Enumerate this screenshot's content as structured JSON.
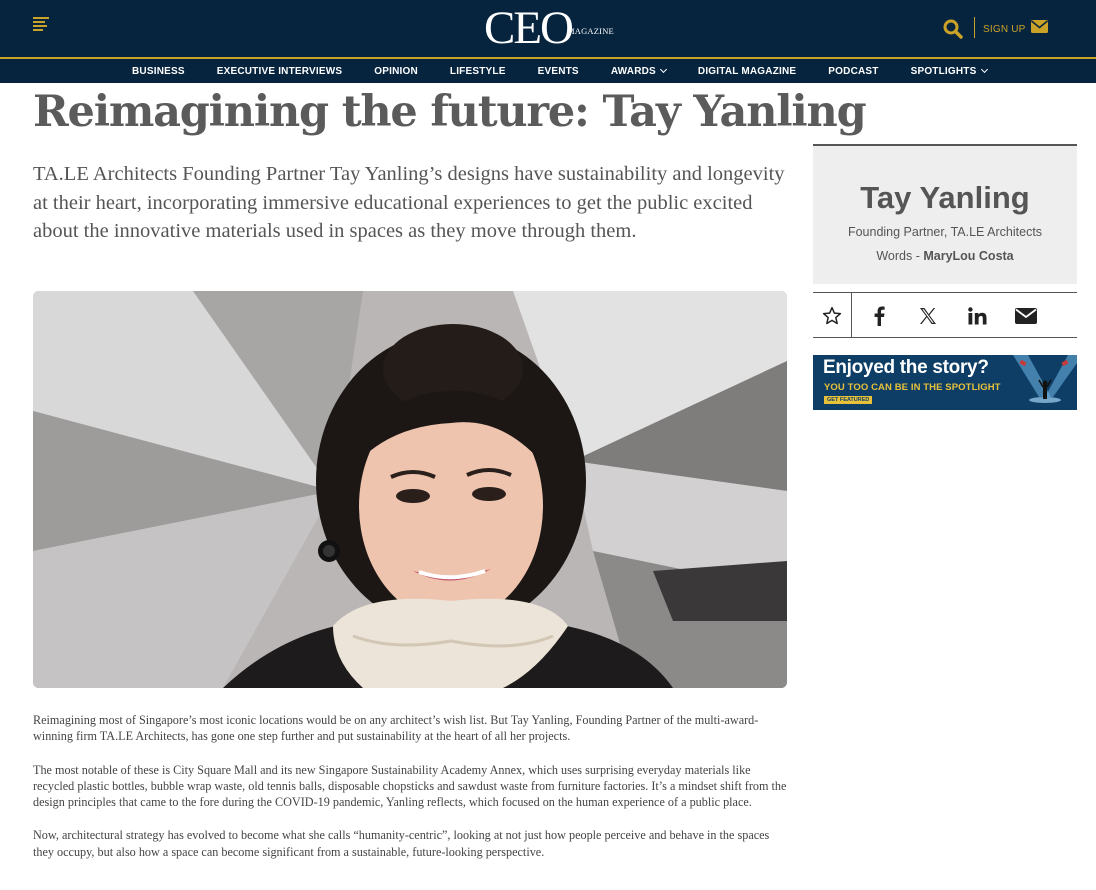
{
  "header": {
    "logo_text": "CEO",
    "logo_sub": "MAGAZINE",
    "signup_label": "SIGN UP",
    "colors": {
      "navy": "#07243f",
      "gold": "#c9a227"
    },
    "icons": [
      "menu-icon",
      "search-icon",
      "mail-icon"
    ]
  },
  "nav": {
    "items": [
      {
        "label": "BUSINESS"
      },
      {
        "label": "EXECUTIVE INTERVIEWS"
      },
      {
        "label": "OPINION"
      },
      {
        "label": "LIFESTYLE"
      },
      {
        "label": "EVENTS"
      },
      {
        "label": "AWARDS",
        "dropdown": true
      },
      {
        "label": "DIGITAL MAGAZINE"
      },
      {
        "label": "PODCAST"
      },
      {
        "label": "SPOTLIGHTS",
        "dropdown": true
      }
    ]
  },
  "article": {
    "headline": "Reimagining the future: Tay Yanling",
    "standfirst": "TA.LE Architects Founding Partner Tay Yanling’s designs have sustainability and longevity at their heart, incorporating immersive educational experiences to get the public excited about the innovative materials used in spaces as they move through them.",
    "paragraphs": [
      "Reimagining most of Singapore’s most iconic locations would be on any architect’s wish list. But Tay Yanling, Founding Partner of the multi-award-winning firm TA.LE Architects, has gone one step further and put sustainability at the heart of all her projects.",
      "The most notable of these is City Square Mall and its new Singapore Sustainability Academy Annex, which uses surprising everyday materials like recycled plastic bottles, bubble wrap waste, old tennis balls, disposable chopsticks and sawdust waste from furniture factories. It’s a mindset shift from the design principles that came to the fore during the COVID-19 pandemic, Yanling reflects, which focused on the human experience of a public place.",
      "Now, architectural strategy has evolved to become what she calls “humanity-centric”, looking at not just how people perceive and behave in the spaces they occupy, but also how a space can become significant from a sustainable, future-looking perspective."
    ]
  },
  "sidebar": {
    "name": "Tay Yanling",
    "role": "Founding Partner, TA.LE Architects",
    "words_label": "Words - ",
    "author": "MaryLou Costa",
    "share_icons": [
      "star-icon",
      "facebook-icon",
      "x-icon",
      "linkedin-icon",
      "mail-icon"
    ],
    "banner": {
      "title": "Enjoyed the story?",
      "subtitle": "YOU TOO CAN BE IN THE SPOTLIGHT",
      "cta": "GET FEATURED"
    }
  }
}
